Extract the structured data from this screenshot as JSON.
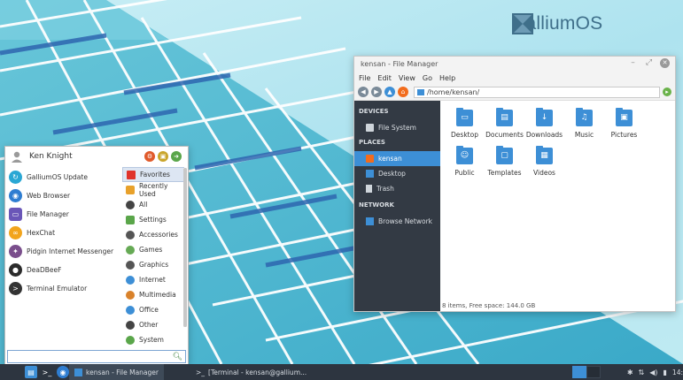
{
  "brand": {
    "name": "GalliumOS"
  },
  "file_manager": {
    "title": "kensan - File Manager",
    "menu": [
      "File",
      "Edit",
      "View",
      "Go",
      "Help"
    ],
    "location": "/home/kensan/",
    "sidebar": {
      "devices_header": "DEVICES",
      "devices": [
        "File System"
      ],
      "places_header": "PLACES",
      "places": [
        "kensan",
        "Desktop",
        "Trash"
      ],
      "network_header": "NETWORK",
      "network": [
        "Browse Network"
      ]
    },
    "folders": [
      {
        "label": "Desktop",
        "icon": "monitor-icon"
      },
      {
        "label": "Documents",
        "icon": "document-icon"
      },
      {
        "label": "Downloads",
        "icon": "download-icon"
      },
      {
        "label": "Music",
        "icon": "music-icon"
      },
      {
        "label": "Pictures",
        "icon": "picture-icon"
      },
      {
        "label": "Public",
        "icon": "people-icon"
      },
      {
        "label": "Templates",
        "icon": "template-icon"
      },
      {
        "label": "Videos",
        "icon": "video-icon"
      }
    ],
    "status": "8 items, Free space: 144.0 GB"
  },
  "start_menu": {
    "user": "Ken Knight",
    "apps": [
      {
        "label": "GalliumOS Update",
        "color": "#2aa7d4"
      },
      {
        "label": "Web Browser",
        "color": "#2e7dd1"
      },
      {
        "label": "File Manager",
        "color": "#6a56b8"
      },
      {
        "label": "HexChat",
        "color": "#f2a41c"
      },
      {
        "label": "Pidgin Internet Messenger",
        "color": "#7a4e8c"
      },
      {
        "label": "DeaDBeeF",
        "color": "#2b2b2b"
      },
      {
        "label": "Terminal Emulator",
        "color": "#333333"
      }
    ],
    "categories": [
      {
        "label": "Favorites",
        "color": "#e0332b"
      },
      {
        "label": "Recently Used",
        "color": "#e8a12b"
      },
      {
        "label": "All",
        "color": "#444444"
      },
      {
        "label": "Settings",
        "color": "#5aa64a"
      },
      {
        "label": "Accessories",
        "color": "#555555"
      },
      {
        "label": "Games",
        "color": "#66aa55"
      },
      {
        "label": "Graphics",
        "color": "#555555"
      },
      {
        "label": "Internet",
        "color": "#3d8fd6"
      },
      {
        "label": "Multimedia",
        "color": "#d9822b"
      },
      {
        "label": "Office",
        "color": "#3d8fd6"
      },
      {
        "label": "Other",
        "color": "#444444"
      },
      {
        "label": "System",
        "color": "#5aa64a"
      }
    ]
  },
  "taskbar": {
    "tasks": [
      "kensan - File Manager",
      "[Terminal - kensan@gallium..."
    ],
    "clock": "14:"
  }
}
